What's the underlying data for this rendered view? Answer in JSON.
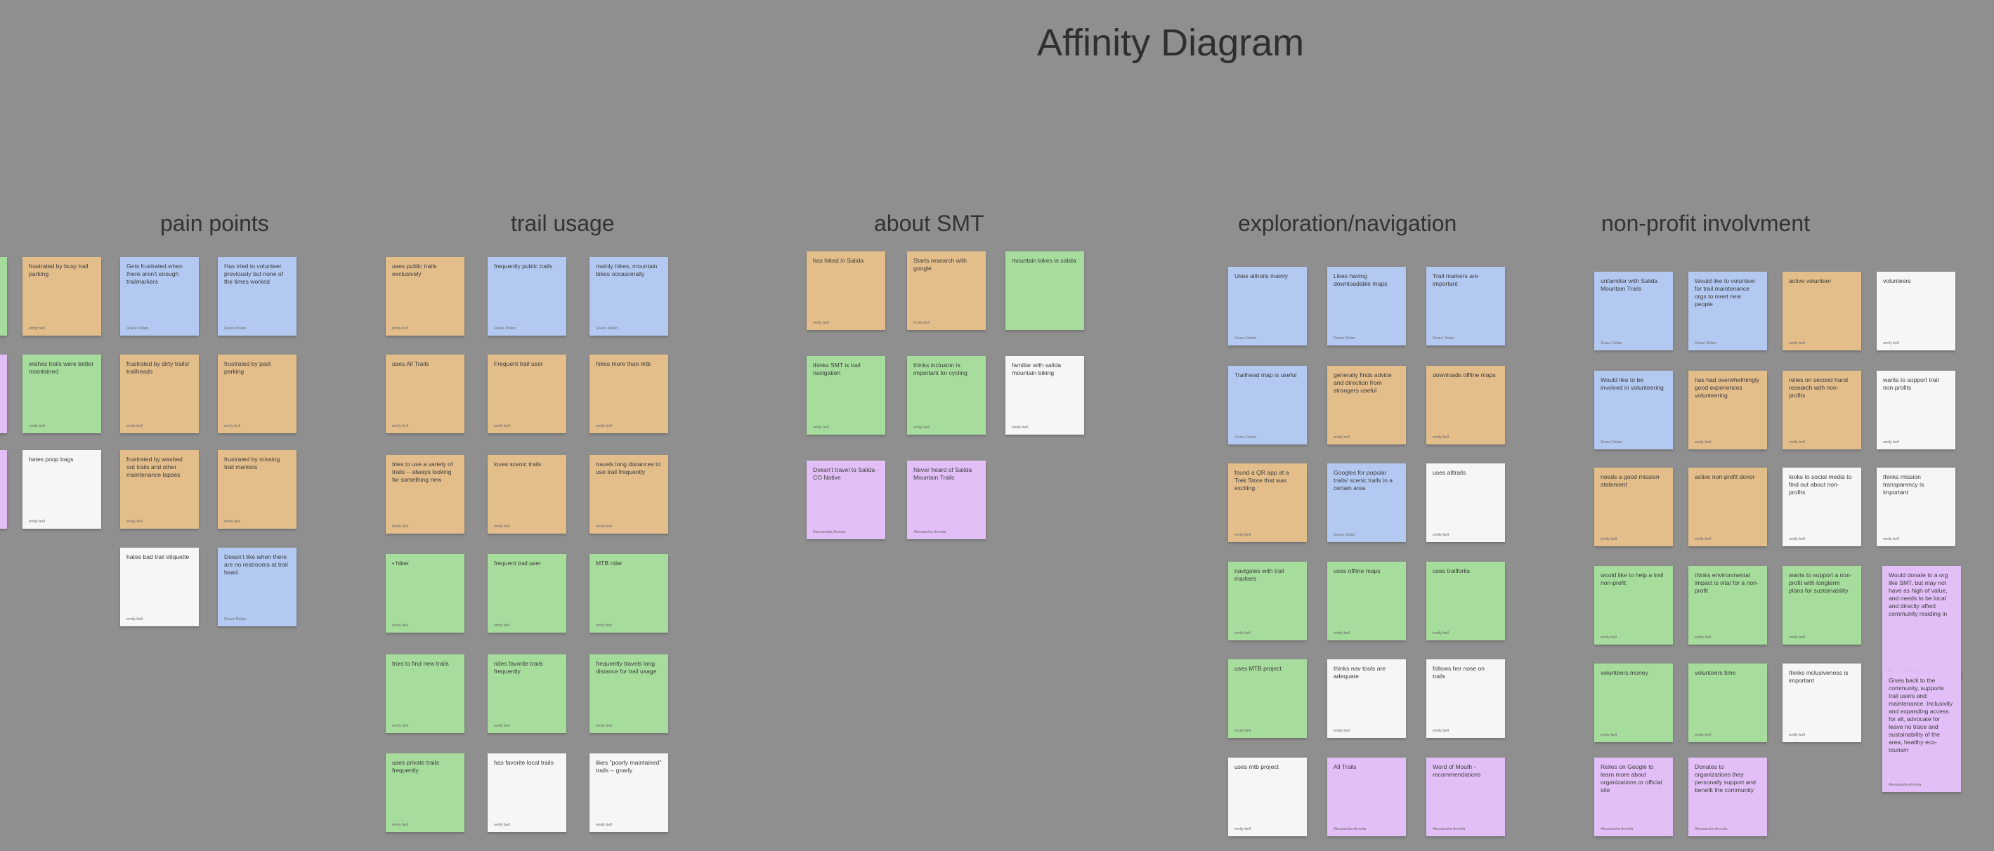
{
  "title": "Affinity Diagram",
  "colors": {
    "background": "#8f8f8f",
    "orange": "#e3bd8a",
    "blue": "#b3c9f2",
    "green": "#a6dd9c",
    "white": "#f6f6f6",
    "purple": "#e2bff7"
  },
  "clusters": [
    {
      "title": "pain points",
      "notes": [
        {
          "text": "",
          "author": "",
          "color": "green"
        },
        {
          "text": "",
          "author": "",
          "color": "purple"
        },
        {
          "text": "",
          "author": "",
          "color": "purple"
        },
        {
          "text": "frustrated by busy trail parking",
          "author": "emily bell",
          "color": "orange"
        },
        {
          "text": "wishes trails were better maintained",
          "author": "emily bell",
          "color": "green"
        },
        {
          "text": "hates poop bags",
          "author": "emily bell",
          "color": "white"
        },
        {
          "text": "Gets frustrated when there aren't enough trailmarkers",
          "author": "Grace Dolan",
          "color": "blue"
        },
        {
          "text": "frustrated by dirty trails/ trailheads",
          "author": "emily bell",
          "color": "orange"
        },
        {
          "text": "frustrated by washed out trails and other maintenance lapses",
          "author": "emily bell",
          "color": "orange"
        },
        {
          "text": "hates bad trail etiquette",
          "author": "emily bell",
          "color": "white"
        },
        {
          "text": "Has tried to volunteer previously but none of the times worked",
          "author": "Grace Dolan",
          "color": "blue"
        },
        {
          "text": "frustrated by past parking",
          "author": "emily bell",
          "color": "orange"
        },
        {
          "text": "frustrated by missing trail markers",
          "author": "emily bell",
          "color": "orange"
        },
        {
          "text": "Doesn't like when there are no restrooms at trail head",
          "author": "Grace Dolan",
          "color": "blue"
        }
      ]
    },
    {
      "title": "trail usage",
      "notes": [
        {
          "text": "uses public trails exclusively",
          "author": "emily bell",
          "color": "orange"
        },
        {
          "text": "uses All Trails",
          "author": "emily bell",
          "color": "orange"
        },
        {
          "text": "tries to use a variety of trails -- always looking for something new",
          "author": "emily bell",
          "color": "orange"
        },
        {
          "text": "• hiker",
          "author": "emily bell",
          "color": "green"
        },
        {
          "text": "tries to find new trails",
          "author": "emily bell",
          "color": "green"
        },
        {
          "text": "uses private trails frequently",
          "author": "emily bell",
          "color": "green"
        },
        {
          "text": "frequently public trails",
          "author": "Grace Dolan",
          "color": "blue"
        },
        {
          "text": "Frequent trail user",
          "author": "emily bell",
          "color": "orange"
        },
        {
          "text": "loves scenic trails",
          "author": "emily bell",
          "color": "orange"
        },
        {
          "text": "frequent trail user",
          "author": "emily bell",
          "color": "green"
        },
        {
          "text": "rides favorite trails frequently",
          "author": "emily bell",
          "color": "green"
        },
        {
          "text": "has favorite local trails",
          "author": "emily bell",
          "color": "white"
        },
        {
          "text": "mainly hikes, mountain bikes occasionally",
          "author": "Grace Dolan",
          "color": "blue"
        },
        {
          "text": "hikes more than mtb",
          "author": "emily bell",
          "color": "orange"
        },
        {
          "text": "travels long distances to use trail frequently",
          "author": "emily bell",
          "color": "orange"
        },
        {
          "text": "MTB rider",
          "author": "emily bell",
          "color": "green"
        },
        {
          "text": "frequently travels long distance for trail usage",
          "author": "emily bell",
          "color": "green"
        },
        {
          "text": "likes \"poorly maintained\" trails -- gnarly",
          "author": "emily bell",
          "color": "white"
        }
      ]
    },
    {
      "title": "about SMT",
      "notes": [
        {
          "text": "has hiked in Salida",
          "author": "emily bell",
          "color": "orange"
        },
        {
          "text": "thinks SMT is trail navigation",
          "author": "emily bell",
          "color": "green"
        },
        {
          "text": "Doesn't travel to Salida - CO Native",
          "author": "Alessandra Arreola",
          "color": "purple"
        },
        {
          "text": "Starts research with google",
          "author": "emily bell",
          "color": "orange"
        },
        {
          "text": "thinks inclusion is important for cycling",
          "author": "emily bell",
          "color": "green"
        },
        {
          "text": "Never heard of Salida Mountain Trails",
          "author": "Alessandra Arreola",
          "color": "purple"
        },
        {
          "text": "mountain bikes in salida",
          "author": "",
          "color": "green"
        },
        {
          "text": "familiar with salida mountain biking",
          "author": "emily bell",
          "color": "white"
        }
      ]
    },
    {
      "title": "exploration/navigation",
      "notes": [
        {
          "text": "Uses alltrails mainly",
          "author": "Grace Dolan",
          "color": "blue"
        },
        {
          "text": "Trailhead map is useful",
          "author": "Grace Dolan",
          "color": "blue"
        },
        {
          "text": "found a QR app at a Trek Store that was exciting",
          "author": "emily bell",
          "color": "orange"
        },
        {
          "text": "navigates with trail markers",
          "author": "emily bell",
          "color": "green"
        },
        {
          "text": "uses MTB project",
          "author": "emily bell",
          "color": "green"
        },
        {
          "text": "uses mtb project",
          "author": "emily bell",
          "color": "white"
        },
        {
          "text": "Likes having downloadable maps",
          "author": "Grace Dolan",
          "color": "blue"
        },
        {
          "text": "generally finds advice and direction from strangers useful",
          "author": "emily bell",
          "color": "orange"
        },
        {
          "text": "Googles for popular trails/ scenic trails in a certain area",
          "author": "Grace Dolan",
          "color": "blue"
        },
        {
          "text": "uses offline maps",
          "author": "emily bell",
          "color": "green"
        },
        {
          "text": "thinks nav tools are adequate",
          "author": "emily bell",
          "color": "white"
        },
        {
          "text": "All Trails",
          "author": "Alessandra Arreola",
          "color": "purple"
        },
        {
          "text": "Trail markers are important",
          "author": "Grace Dolan",
          "color": "blue"
        },
        {
          "text": "downloads offline maps",
          "author": "emily bell",
          "color": "orange"
        },
        {
          "text": "uses alltrails",
          "author": "emily bell",
          "color": "white"
        },
        {
          "text": "uses trailforks",
          "author": "emily bell",
          "color": "green"
        },
        {
          "text": "follows her nose on trails",
          "author": "emily bell",
          "color": "white"
        },
        {
          "text": "Word of Mouth - recommendations",
          "author": "Alessandra Arreola",
          "color": "purple"
        }
      ]
    },
    {
      "title": "non-profit involvment",
      "notes": [
        {
          "text": "unfamiliar with Salida Mountain Trails",
          "author": "Grace Dolan",
          "color": "blue"
        },
        {
          "text": "Would like to be involved in volunteering",
          "author": "Grace Dolan",
          "color": "blue"
        },
        {
          "text": "needs a good mission statement",
          "author": "emily bell",
          "color": "orange"
        },
        {
          "text": "would like to help a trail non-profit",
          "author": "emily bell",
          "color": "green"
        },
        {
          "text": "volunteers money",
          "author": "emily bell",
          "color": "green"
        },
        {
          "text": "Relies on Google to learn more about organizations or official site",
          "author": "Alessandra Arreola",
          "color": "purple"
        },
        {
          "text": "Would like to volunteer for trail maintenance orgs to meet new people",
          "author": "Grace Dolan",
          "color": "blue"
        },
        {
          "text": "has had overwhelmingly good experiences volunteering",
          "author": "emily bell",
          "color": "orange"
        },
        {
          "text": "active non-profit donor",
          "author": "emily bell",
          "color": "orange"
        },
        {
          "text": "thinks environmental impact is vital for a non-profit",
          "author": "emily bell",
          "color": "green"
        },
        {
          "text": "volunteers time",
          "author": "emily bell",
          "color": "green"
        },
        {
          "text": "Donates to organizations they personally support and benefit the community",
          "author": "Alessandra Arreola",
          "color": "purple"
        },
        {
          "text": "active volunteer",
          "author": "emily bell",
          "color": "orange"
        },
        {
          "text": "relies on second hand research with non-profits",
          "author": "emily bell",
          "color": "orange"
        },
        {
          "text": "looks to social media to find out about non-profits",
          "author": "emily bell",
          "color": "white"
        },
        {
          "text": "wants to support a non-profit with longterm plans for sustainability",
          "author": "emily bell",
          "color": "green"
        },
        {
          "text": "thinks inclusiveness is important",
          "author": "emily bell",
          "color": "white"
        },
        {
          "text": "volunteers",
          "author": "emily bell",
          "color": "white"
        },
        {
          "text": "wants to support trail non profits",
          "author": "emily bell",
          "color": "white"
        },
        {
          "text": "thinks mission transparency is important",
          "author": "emily bell",
          "color": "white"
        },
        {
          "text": "Would donate to a org like SMT, but may not have as high of value, and needs to be local and directly affect community residing in",
          "author": "Alessandra Arreola",
          "color": "purple"
        },
        {
          "text": "Gives back to the community, supports trail users and maintenance. Inclusivity and expanding access for all, advocate for leave no trace and sustainability of the area, healthy eco-tourism",
          "author": "Alessandra Arreola",
          "color": "purple"
        }
      ]
    }
  ]
}
